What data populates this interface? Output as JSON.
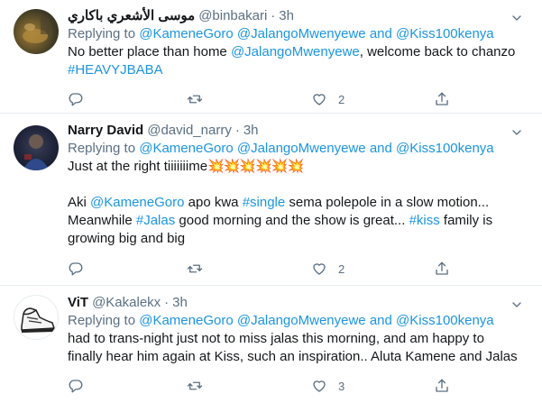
{
  "tweets": [
    {
      "name": "موسى الأشعري باكاري",
      "handle": "@binbakari",
      "time": "3h",
      "replying_prefix": "Replying to",
      "replying_to": [
        "@KameneGoro",
        "@JalangoMwenyewe",
        "and",
        "@Kiss100kenya"
      ],
      "text_parts": [
        "No better place than home ",
        "@JalangoMwenyewe",
        ", welcome back to chanzo"
      ],
      "hashtag": "#HEAVYJBABA",
      "likes": "2"
    },
    {
      "name": "Narry David",
      "handle": "@david_narry",
      "time": "3h",
      "replying_prefix": "Replying to",
      "replying_to": [
        "@KameneGoro",
        "@JalangoMwenyewe",
        "and",
        "@Kiss100kenya"
      ],
      "line1": "Just at the right tiiiiiiime",
      "emojis": "💥💥💥💥💥💥",
      "line2_parts": [
        "Aki ",
        "@KameneGoro",
        " apo kwa ",
        "#single",
        " sema polepole in a slow motion..."
      ],
      "line3_parts": [
        "Meanwhile ",
        "#Jalas",
        " good morning and the show is great... ",
        "#kiss",
        " family is"
      ],
      "line4": "growing big and big",
      "likes": "2"
    },
    {
      "name": "ViT",
      "handle": "@Kakalekx",
      "time": "3h",
      "replying_prefix": "Replying to",
      "replying_to": [
        "@KameneGoro",
        "@JalangoMwenyewe",
        "and",
        "@Kiss100kenya"
      ],
      "line1": "had to trans-night just not to miss jalas this morning, and am happy to",
      "line2": "finally hear him again at Kiss, such an inspiration.. Aluta Kamene and Jalas",
      "likes": "3"
    }
  ],
  "icons": {
    "reply": "reply-icon",
    "retweet": "retweet-icon",
    "like": "heart-icon",
    "share": "share-icon",
    "more": "chevron-down-icon"
  },
  "colors": {
    "link": "#1b95e0",
    "muted": "#5b7083",
    "border": "#e6ecf0"
  }
}
